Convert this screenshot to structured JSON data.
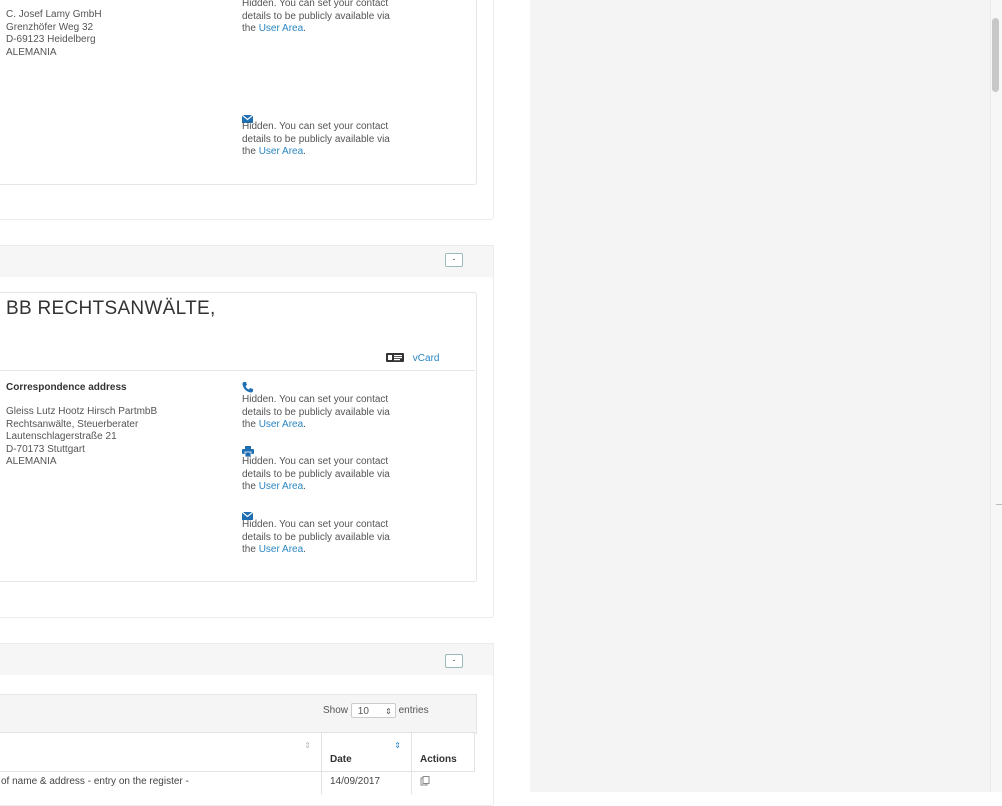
{
  "lamy": {
    "address_lines": [
      "C. Josef Lamy GmbH",
      "Grenzhöfer Weg 32",
      "D-69123 Heidelberg",
      "ALEMANIA"
    ],
    "hidden_prefix": "Hidden. You can set your contact details to be publicly available via the ",
    "user_area": "User Area",
    "top_partial_1": "Hidden. You can set your contact",
    "top_partial_2": "details to be publicly available via",
    "top_partial_3": "the ",
    "period": "."
  },
  "representative": {
    "collapse_symbol": "-",
    "title": "BB RECHTSANWÄLTE,",
    "vcard_label": "vCard",
    "correspondence_heading": "Correspondence address",
    "address_lines": [
      "Gleiss Lutz Hootz Hirsch PartmbB",
      "Rechtsanwälte, Steuerberater",
      "Lautenschlagerstraße 21",
      "D-70173 Stuttgart",
      "ALEMANIA"
    ],
    "hidden_line1": "Hidden. You can set your contact",
    "hidden_line2": "details to be publicly available via",
    "hidden_line3": "the ",
    "user_area": "User Area",
    "period": "."
  },
  "history": {
    "collapse_symbol": "-",
    "show_label": "Show",
    "entries_value": "10",
    "entries_label": "entries",
    "col_date": "Date",
    "col_actions": "Actions",
    "row_text": "of name & address - entry on the register -",
    "row_date": "14/09/2017"
  },
  "icons": {
    "phone": "phone-icon",
    "fax": "fax-icon",
    "email": "email-icon",
    "vcard": "vcard-icon"
  },
  "colors": {
    "link": "#2a86c4",
    "background_right": "#f4f4f4"
  }
}
